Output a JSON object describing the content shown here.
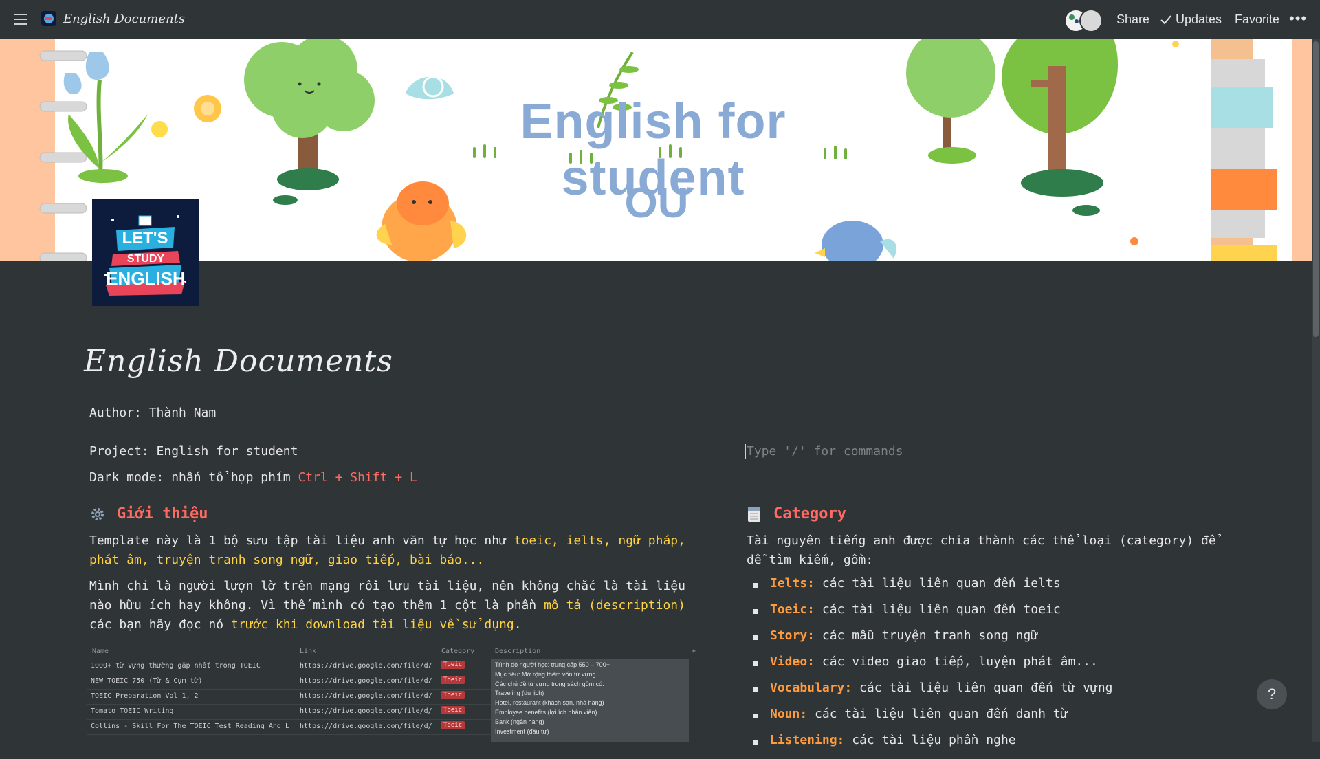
{
  "topbar": {
    "breadcrumb": "English Documents",
    "share": "Share",
    "updates": "Updates",
    "favorite": "Favorite",
    "more": "•••"
  },
  "cover": {
    "title": "English for student",
    "subtitle": "OU",
    "logo_text": [
      "LET'S",
      "STUDY",
      "ENGLISH"
    ]
  },
  "page": {
    "title": "English Documents",
    "author": "Author: Thành Nam",
    "project": "Project: English for student",
    "darkmode_label": "Dark mode: nhấn tổ hợp phím ",
    "darkmode_keys": "Ctrl + Shift + L",
    "command_placeholder": "Type '/' for commands"
  },
  "intro": {
    "heading": "Giới thiệu",
    "p1_a": "Template này là 1 bộ sưu tập tài liệu anh văn tự học như ",
    "p1_b": "toeic, ielts, ngữ pháp, phát âm, truyện tranh song ngữ, giao tiếp, bài báo...",
    "p2_a": "Mình chỉ là người lượn lờ trên mạng rồi lưu tài liệu, nên không chắc là tài liệu nào hữu ích hay không. Vì thế mình có tạo thêm 1 cột là phần ",
    "p2_b": "mô tả (description)",
    "p2_c": " các bạn hãy đọc nó ",
    "p2_d": "trước khi download tài liệu về sử dụng",
    "p2_e": "."
  },
  "category": {
    "heading": "Category",
    "intro": "Tài nguyên tiếng anh được chia thành các thể loại (category) để dễ tìm kiếm, gồm:",
    "items": [
      {
        "key": "Ielts:",
        "text": " các tài liệu liên quan đến ielts"
      },
      {
        "key": "Toeic:",
        "text": " các tài liệu liên quan đến toeic"
      },
      {
        "key": "Story:",
        "text": " các mẫu truyện tranh song ngữ"
      },
      {
        "key": "Video:",
        "text": " các video giao tiếp, luyện phát âm..."
      },
      {
        "key": "Vocabulary:",
        "text": " các tài liệu liên quan đến từ vựng"
      },
      {
        "key": "Noun:",
        "text": " các tài liệu liên quan đến danh từ"
      },
      {
        "key": "Listening:",
        "text": " các tài liệu phần nghe"
      }
    ]
  },
  "table": {
    "headers": [
      "Name",
      "Link",
      "Category",
      "Description",
      "+"
    ],
    "rows": [
      {
        "name": "1000+ từ vựng thường gặp nhất trong TOEIC",
        "link": "https://drive.google.com/file/d/",
        "tag": "Toeic"
      },
      {
        "name": "NEW TOEIC 750 (Từ & Cụm từ)",
        "link": "https://drive.google.com/file/d/",
        "tag": "Toeic"
      },
      {
        "name": "TOEIC Preparation Vol 1, 2",
        "link": "https://drive.google.com/file/d/",
        "tag": "Toeic"
      },
      {
        "name": "Tomato TOEIC Writing",
        "link": "https://drive.google.com/file/d/",
        "tag": "Toeic"
      },
      {
        "name": "Collins - Skill For The TOEIC Test Reading And L",
        "link": "https://drive.google.com/file/d/",
        "tag": "Toeic"
      }
    ],
    "description_lines": [
      "Trình độ người học: trung cấp 550 – 700+",
      "Mục tiêu: Mở rộng thêm vốn từ vựng.",
      "Các chủ đề từ vựng trong sách gồm có:",
      "Traveling (du lịch)",
      "Hotel, restaurant (khách sạn, nhà hàng)",
      "Employee benefits (lợi ích nhân viên)",
      "Bank (ngân hàng)",
      "Investment (đầu tư)"
    ]
  },
  "help": "?",
  "colors": {
    "background": "#2f3437",
    "heading_red": "#ff6b63",
    "highlight_yellow": "#ffd23f",
    "category_key_orange": "#ff9b3d",
    "tag_red": "#b5393a"
  }
}
